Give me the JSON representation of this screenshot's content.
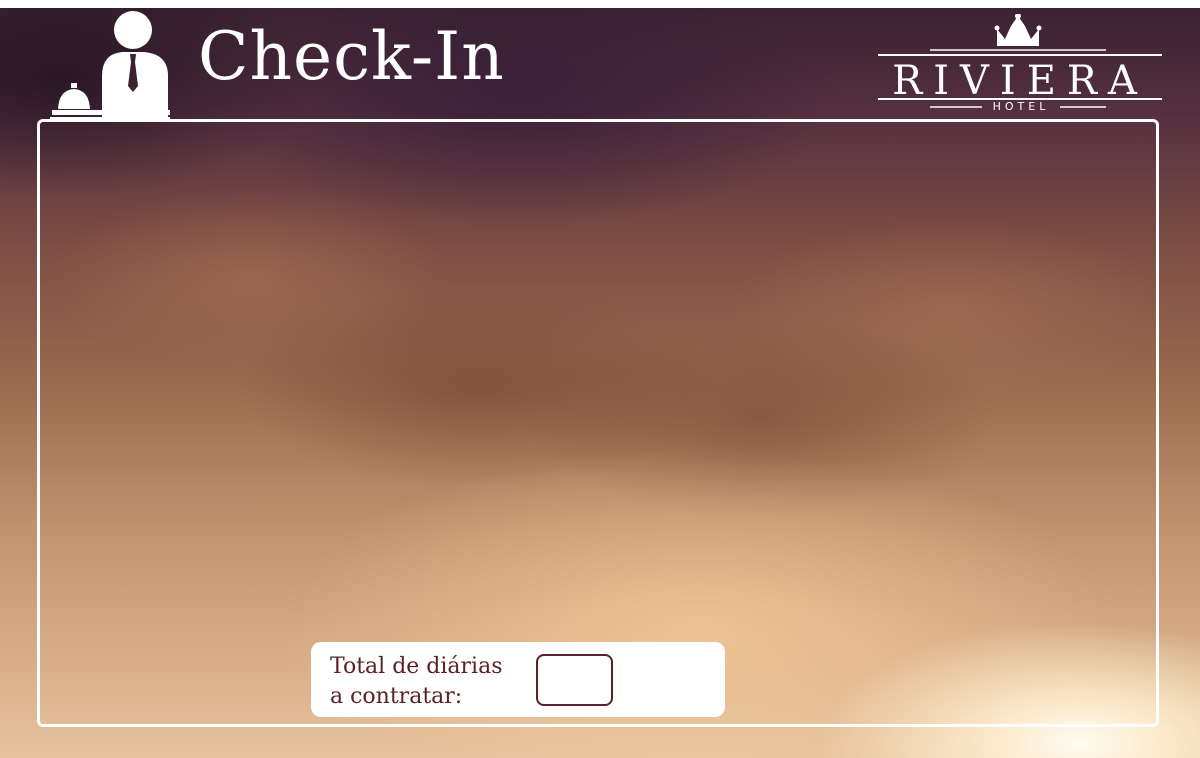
{
  "header": {
    "title": "Check-In",
    "icon": "receptionist-with-bell-icon"
  },
  "brand": {
    "name": "RIVIERA",
    "subtitle": "HOTEL",
    "icon": "crown-icon"
  },
  "form": {
    "days_label_line1": "Total de diárias",
    "days_label_line2": "a contratar:",
    "days_value": ""
  },
  "colors": {
    "accent": "#5a2226",
    "frame": "#ffffff"
  }
}
